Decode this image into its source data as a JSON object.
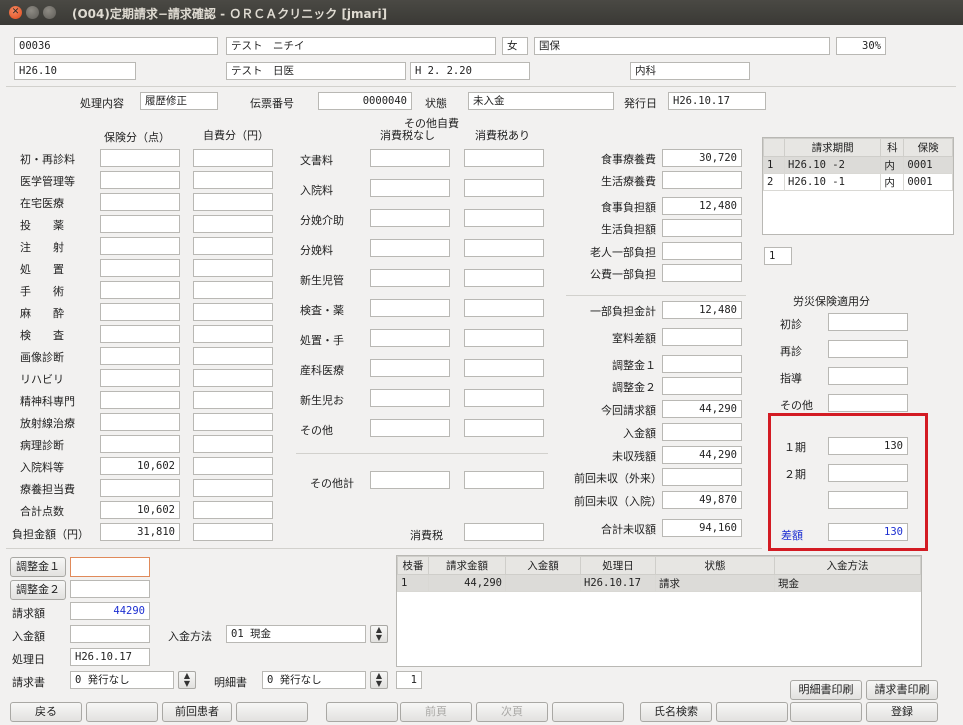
{
  "window": {
    "title": "(O04)定期請求−請求確認 - ＯＲＣＡクリニック [jmari]"
  },
  "patient": {
    "id": "00036",
    "name": "テスト　ニチイ",
    "sex": "女",
    "insurance": "国保",
    "rate": "30%",
    "era": "H26.10",
    "doctor": "テスト　日医",
    "birth": "H 2. 2.20",
    "dept": "内科"
  },
  "header": {
    "shori_label": "処理内容",
    "shori_value": "履歴修正",
    "denpyo_label": "伝票番号",
    "denpyo_value": "0000040",
    "status_label": "状態",
    "status_value": "未入金",
    "hakko_label": "発行日",
    "hakko_value": "H26.10.17"
  },
  "col_heads": {
    "hoken": "保険分（点）",
    "jihi": "自費分（円）",
    "sonota_jihi": "その他自費",
    "tax_none": "消費税なし",
    "tax_yes": "消費税あり"
  },
  "left_rows": [
    {
      "label": "初・再診料",
      "hoken": "",
      "jihi": ""
    },
    {
      "label": "医学管理等",
      "hoken": "",
      "jihi": ""
    },
    {
      "label": "在宅医療",
      "hoken": "",
      "jihi": ""
    },
    {
      "label": "投　　薬",
      "hoken": "",
      "jihi": ""
    },
    {
      "label": "注　　射",
      "hoken": "",
      "jihi": ""
    },
    {
      "label": "処　　置",
      "hoken": "",
      "jihi": ""
    },
    {
      "label": "手　　術",
      "hoken": "",
      "jihi": ""
    },
    {
      "label": "麻　　酔",
      "hoken": "",
      "jihi": ""
    },
    {
      "label": "検　　査",
      "hoken": "",
      "jihi": ""
    },
    {
      "label": "画像診断",
      "hoken": "",
      "jihi": ""
    },
    {
      "label": "リハビリ",
      "hoken": "",
      "jihi": ""
    },
    {
      "label": "精神科専門",
      "hoken": "",
      "jihi": ""
    },
    {
      "label": "放射線治療",
      "hoken": "",
      "jihi": ""
    },
    {
      "label": "病理診断",
      "hoken": "",
      "jihi": ""
    },
    {
      "label": "入院料等",
      "hoken": "10,602",
      "jihi": ""
    },
    {
      "label": "療養担当費",
      "hoken": "",
      "jihi": ""
    },
    {
      "label": "合計点数",
      "hoken": "10,602",
      "jihi": ""
    }
  ],
  "futan": {
    "label": "負担金額（円）",
    "hoken": "31,810",
    "jihi": ""
  },
  "middle_rows": [
    {
      "label": "文書料",
      "a": "",
      "b": ""
    },
    {
      "label": "入院料",
      "a": "",
      "b": ""
    },
    {
      "label": "分娩介助",
      "a": "",
      "b": ""
    },
    {
      "label": "分娩料",
      "a": "",
      "b": ""
    },
    {
      "label": "新生児管",
      "a": "",
      "b": ""
    },
    {
      "label": "検査・薬",
      "a": "",
      "b": ""
    },
    {
      "label": "処置・手",
      "a": "",
      "b": ""
    },
    {
      "label": "産科医療",
      "a": "",
      "b": ""
    },
    {
      "label": "新生児お",
      "a": "",
      "b": ""
    },
    {
      "label": "その他",
      "a": "",
      "b": ""
    }
  ],
  "sonota_kei": {
    "label": "その他計",
    "a": "",
    "b": ""
  },
  "shohizei": {
    "label": "消費税",
    "value": ""
  },
  "right_rows": [
    {
      "label": "食事療養費",
      "value": "30,720"
    },
    {
      "label": "生活療養費",
      "value": ""
    },
    {
      "label": "食事負担額",
      "value": "12,480"
    },
    {
      "label": "生活負担額",
      "value": ""
    },
    {
      "label": "老人一部負担",
      "value": ""
    },
    {
      "label": "公費一部負担",
      "value": ""
    },
    {
      "label": "一部負担金計",
      "value": "12,480"
    },
    {
      "label": "室料差額",
      "value": ""
    },
    {
      "label": "調整金１",
      "value": ""
    },
    {
      "label": "調整金２",
      "value": ""
    },
    {
      "label": "今回請求額",
      "value": "44,290"
    },
    {
      "label": "入金額",
      "value": ""
    },
    {
      "label": "未収残額",
      "value": "44,290"
    },
    {
      "label": "前回未収（外来）",
      "value": ""
    },
    {
      "label": "前回未収（入院）",
      "value": "49,870"
    },
    {
      "label": "合計未収額",
      "value": "94,160"
    }
  ],
  "period_table": {
    "headers": [
      "",
      "請求期間",
      "科",
      "保険"
    ],
    "rows": [
      {
        "no": "1",
        "period": "H26.10 -2",
        "ka": "内",
        "hoken": "0001"
      },
      {
        "no": "2",
        "period": "H26.10 -1",
        "ka": "内",
        "hoken": "0001"
      }
    ],
    "page_value": "1"
  },
  "rousai": {
    "title": "労災保険適用分",
    "rows": [
      {
        "label": "初診",
        "value": ""
      },
      {
        "label": "再診",
        "value": ""
      },
      {
        "label": "指導",
        "value": ""
      },
      {
        "label": "その他",
        "value": ""
      }
    ]
  },
  "kiki": {
    "rows": [
      {
        "label": "１期",
        "value": "130"
      },
      {
        "label": "２期",
        "value": ""
      },
      {
        "label": "",
        "value": ""
      }
    ],
    "sagaku_label": "差額",
    "sagaku_value": "130"
  },
  "bottom_left": {
    "chosei1_btn": "調整金１",
    "chosei1_value": "",
    "chosei2_btn": "調整金２",
    "chosei2_value": "",
    "seikyu_label": "請求額",
    "seikyu_value": "44290",
    "nyukin_label": "入金額",
    "nyukin_value": "",
    "nyukin_method_label": "入金方法",
    "nyukin_method_value": "01 現金",
    "shoribi_label": "処理日",
    "shoribi_value": "H26.10.17",
    "seikyusho_label": "請求書",
    "seikyusho_value": "0 発行なし",
    "meisaisho_label": "明細書",
    "meisaisho_value": "0 発行なし",
    "copies_value": "1"
  },
  "payment_table": {
    "headers": [
      "枝番",
      "請求金額",
      "入金額",
      "処理日",
      "状態",
      "入金方法"
    ],
    "rows": [
      {
        "no": "1",
        "seikyu": "44,290",
        "nyukin": "",
        "date": "H26.10.17",
        "state": "請求",
        "method": "現金"
      }
    ]
  },
  "print_buttons": {
    "meisai": "明細書印刷",
    "seikyu": "請求書印刷"
  },
  "footer": {
    "back": "戻る",
    "prev_patient": "前回患者",
    "prev_page": "前頁",
    "next_page": "次頁",
    "name_search": "氏名検索",
    "register": "登録"
  },
  "colors": {
    "highlight_border": "#d31b23",
    "blue_text": "#1c2fd1"
  }
}
